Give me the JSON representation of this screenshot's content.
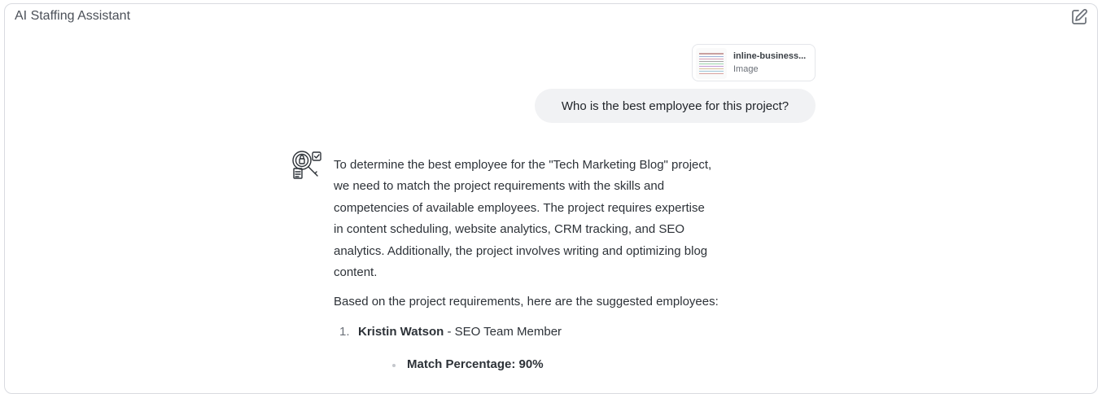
{
  "app": {
    "title": "AI Staffing Assistant"
  },
  "toolbar": {
    "edit_icon": "edit-icon"
  },
  "attachment": {
    "name": "inline-business...",
    "type": "Image"
  },
  "user_message": "Who is the best employee for this project?",
  "assistant": {
    "avatar_icon": "robot-analyst-icon",
    "paragraph1_lines": [
      "To determine the best employee for the \"Tech Marketing Blog\" project,",
      "we need to match the project requirements with the skills and",
      "competencies of available employees. The project requires expertise",
      "in content scheduling, website analytics, CRM tracking, and SEO",
      "analytics. Additionally, the project involves writing and optimizing blog",
      "content."
    ],
    "paragraph2": "Based on the project requirements, here are the suggested employees:",
    "suggestions": [
      {
        "number": "1.",
        "name": "Kristin Watson",
        "role": " - SEO Team Member",
        "details": [
          "Match Percentage: 90%"
        ]
      }
    ]
  }
}
